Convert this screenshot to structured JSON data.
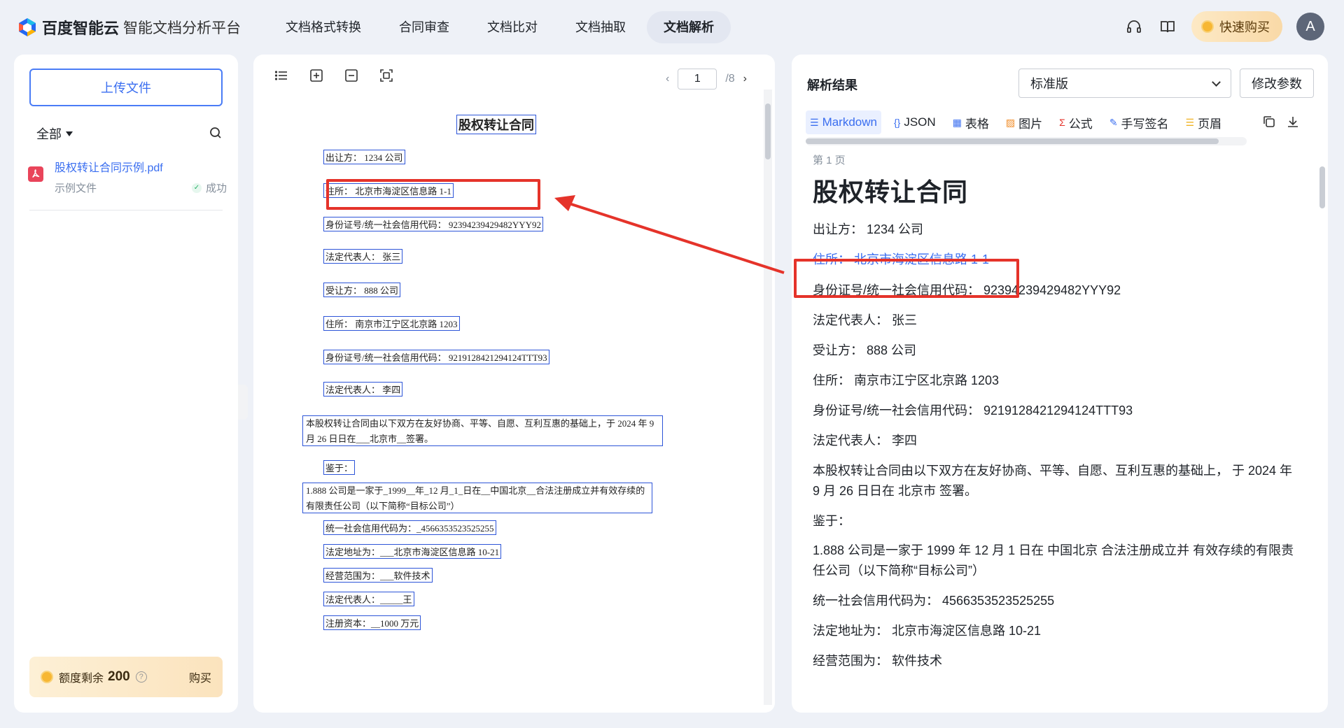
{
  "header": {
    "brand": "百度智能云",
    "product": "智能文档分析平台",
    "nav": [
      {
        "label": "文档格式转换",
        "active": false
      },
      {
        "label": "合同审查",
        "active": false
      },
      {
        "label": "文档比对",
        "active": false
      },
      {
        "label": "文档抽取",
        "active": false
      },
      {
        "label": "文档解析",
        "active": true
      }
    ],
    "buy_label": "快速购买",
    "avatar_letter": "A"
  },
  "left": {
    "upload_label": "上传文件",
    "filter_label": "全部",
    "file": {
      "name": "股权转让合同示例.pdf",
      "sub": "示例文件",
      "status": "成功"
    },
    "quota_label": "额度剩余",
    "quota_value": "200",
    "quota_buy": "购买"
  },
  "middle": {
    "page_current": "1",
    "page_total": "/8",
    "doc": {
      "title": "股权转让合同",
      "lines": [
        "出让方：    1234 公司",
        "住所：    北京市海淀区信息路 1-1",
        "身份证号/统一社会信用代码：    92394239429482YYY92",
        "法定代表人：      张三",
        "受让方：          888 公司",
        "住所：        南京市江宁区北京路 1203",
        "身份证号/统一社会信用代码：    9219128421294124TTT93",
        "法定代表人：     李四",
        "本股权转让合同由以下双方在友好协商、平等、自愿、互利互惠的基础上，于 2024 年 9 月 26 日日在___北京市__签署。",
        "鉴于：",
        "1.888 公司是一家于_1999__年_12 月_1_日在__中国北京__合法注册成立并有效存续的有限责任公司（以下简称“目标公司”）",
        "统一社会信用代码为：_4566353523525255",
        "法定地址为：___北京市海淀区信息路 10-21",
        "经营范围为：___软件技术",
        "法定代表人：_____王",
        "注册资本：__1000 万元"
      ]
    }
  },
  "right": {
    "title": "解析结果",
    "version": "标准版",
    "modify_label": "修改参数",
    "tabs": [
      {
        "icon": "☰",
        "label": "Markdown",
        "active": true
      },
      {
        "icon": "{}",
        "label": "JSON",
        "active": false
      },
      {
        "icon": "▦",
        "label": "表格",
        "active": false
      },
      {
        "icon": "▨",
        "label": "图片",
        "active": false
      },
      {
        "icon": "Σ",
        "label": "公式",
        "active": false
      },
      {
        "icon": "✎",
        "label": "手写签名",
        "active": false
      },
      {
        "icon": "☰",
        "label": "页眉",
        "active": false
      }
    ],
    "page_label": "第 1 页",
    "heading": "股权转让合同",
    "paragraphs": [
      "出让方：  1234 公司",
      "住所：  北京市海淀区信息路 1-1",
      "身份证号/统一社会信用代码：  92394239429482YYY92",
      "法定代表人：  张三",
      "受让方：  888 公司",
      "住所：  南京市江宁区北京路 1203",
      "身份证号/统一社会信用代码：  9219128421294124TTT93",
      "法定代表人：  李四",
      "本股权转让合同由以下双方在友好协商、平等、自愿、互利互惠的基础上， 于 2024 年 9 月 26 日日在 北京市 签署。",
      "鉴于：",
      "1.888 公司是一家于 1999 年 12 月 1 日在 中国北京 合法注册成立并 有效存续的有限责任公司（以下简称“目标公司”）",
      "统一社会信用代码为：  4566353523525255",
      "法定地址为：  北京市海淀区信息路 10-21",
      "经营范围为：  软件技术"
    ]
  },
  "colors": {
    "accent": "#3a6ef0",
    "annotation_red": "#e5332a",
    "box_blue": "#2d55d8"
  }
}
